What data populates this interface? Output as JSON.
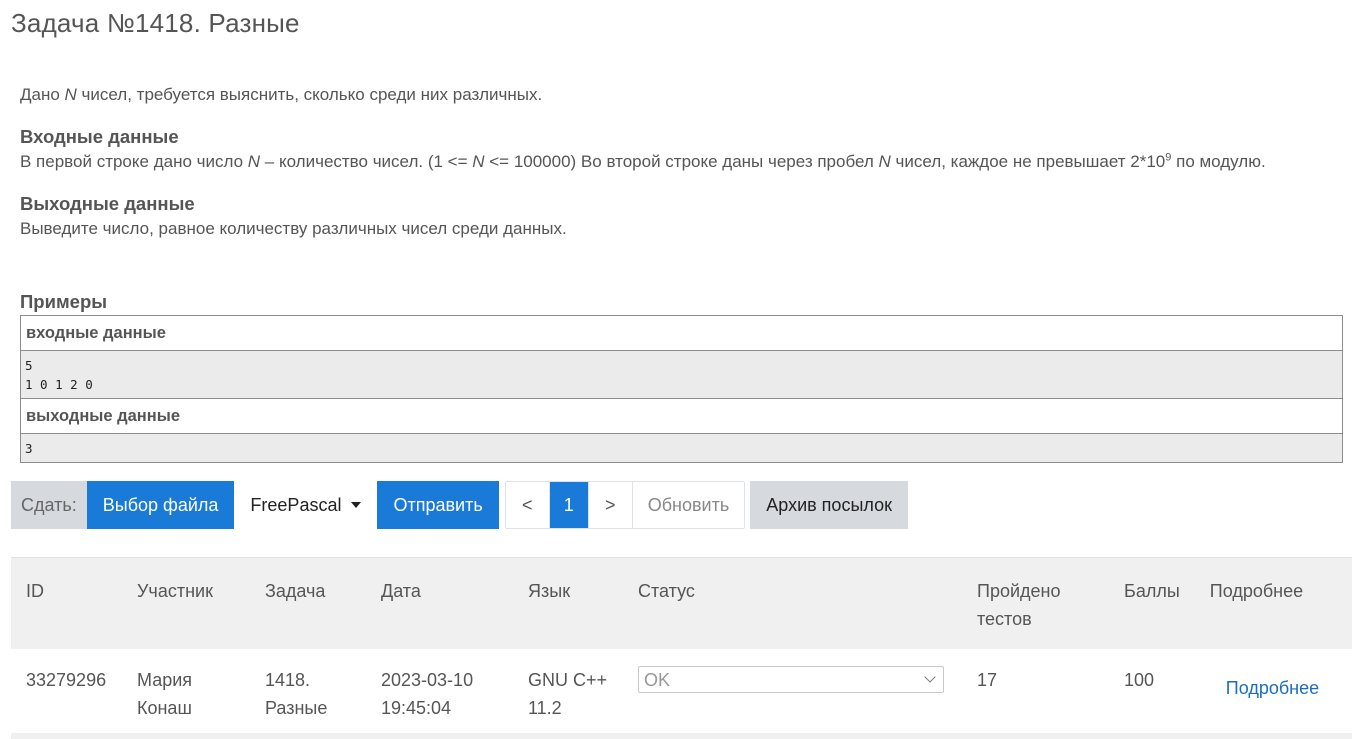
{
  "problem": {
    "title": "Задача №1418. Разные",
    "intro_pre": "Дано ",
    "intro_var": "N",
    "intro_post": " чисел, требуется выяснить, сколько среди них различных.",
    "input": {
      "heading": "Входные данные",
      "t1": "В первой строке дано число ",
      "v1": "N",
      "t2": " – количество чисел. (1 <= ",
      "v2": "N",
      "t3": " <= 100000) Во второй строке даны через пробел ",
      "v3": "N",
      "t4": " чисел, каждое не превышает 2*10",
      "sup": "9",
      "t5": " по модулю."
    },
    "output": {
      "heading": "Выходные данные",
      "text": "Выведите число, равное количеству различных чисел среди данных."
    },
    "examples": {
      "heading": "Примеры",
      "input_label": "входные данные",
      "input_value": "5\n1 0 1 2 0",
      "output_label": "выходные данные",
      "output_value": "3"
    }
  },
  "toolbar": {
    "submit_label": "Сдать:",
    "choose_file": "Выбор файла",
    "language": "FreePascal",
    "send": "Отправить",
    "prev": "<",
    "page": "1",
    "next": ">",
    "refresh": "Обновить",
    "archive": "Архив посылок"
  },
  "submissions": {
    "headers": [
      "ID",
      "Участник",
      "Задача",
      "Дата",
      "Язык",
      "Статус",
      "Пройдено тестов",
      "Баллы",
      "Подробнее"
    ],
    "rows": [
      {
        "id": "33279296",
        "participant": "Мария Конаш",
        "task": "1418. Разные",
        "date": "2023-03-10 19:45:04",
        "language": "GNU C++ 11.2",
        "status": "OK",
        "tests": "17",
        "score": "100",
        "details": "Подробнее"
      }
    ]
  }
}
